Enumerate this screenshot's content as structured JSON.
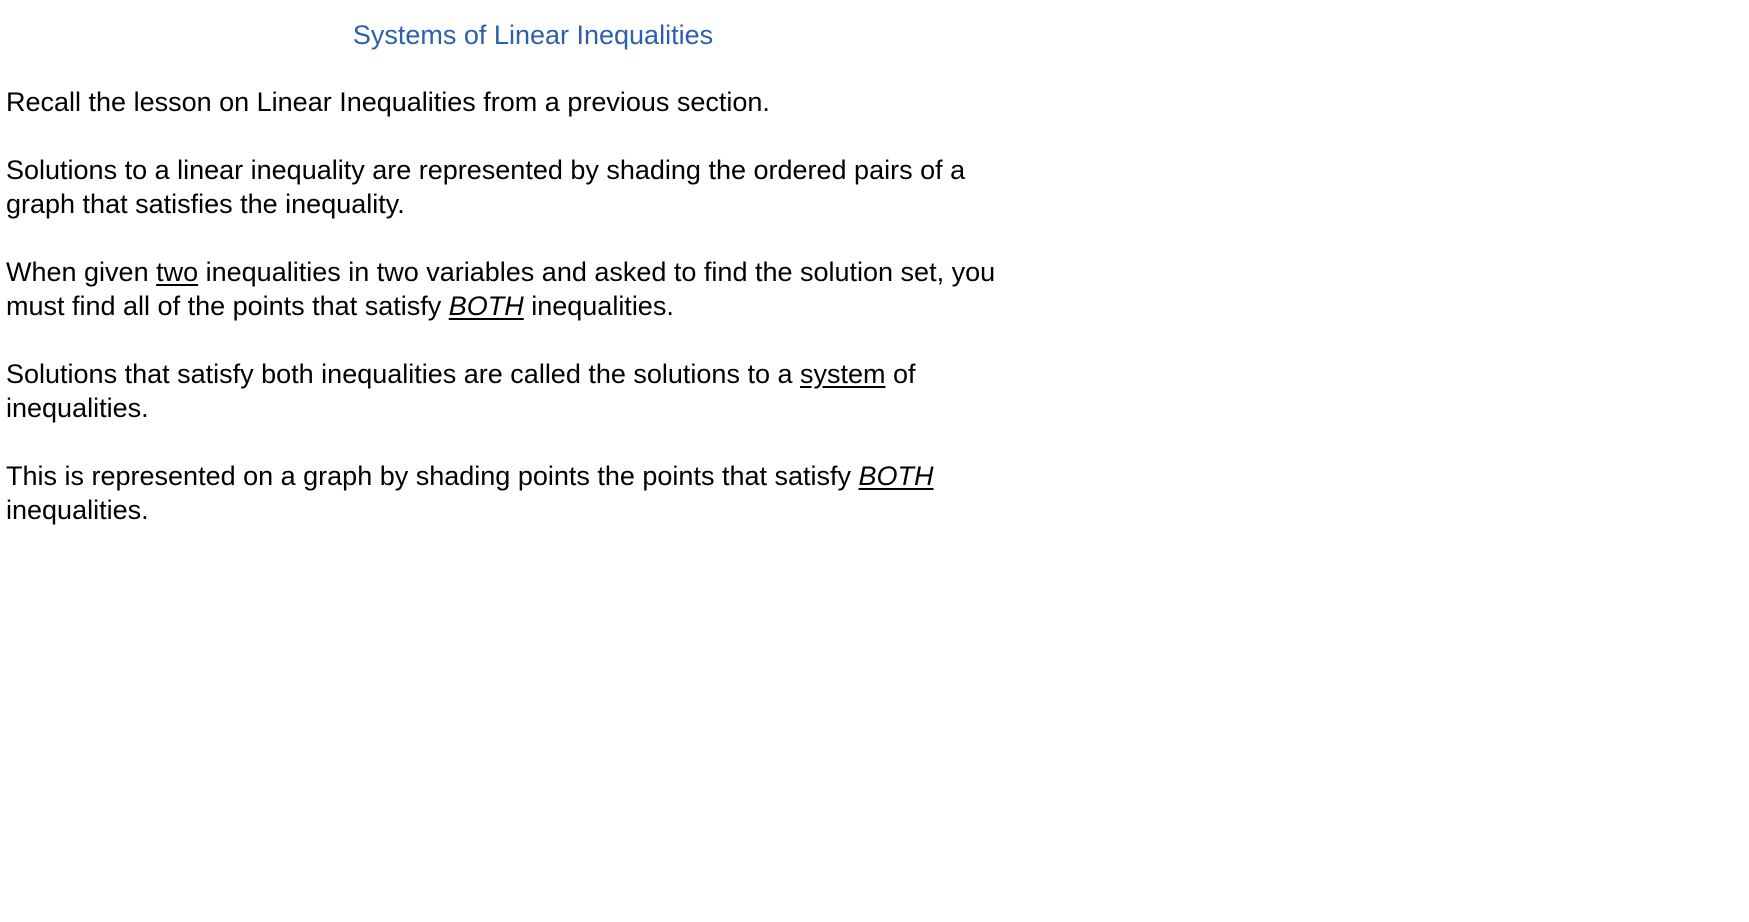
{
  "title": "Systems of Linear Inequalities",
  "colors": {
    "title": "#2e5fae",
    "text": "#000000",
    "background": "#ffffff"
  },
  "paragraphs": {
    "p1": {
      "text": "Recall the lesson on Linear Inequalities from a previous section."
    },
    "p2": {
      "line1": "Solutions to a linear inequality are represented by shading the ordered pairs of a",
      "line2": "graph that satisfies the inequality."
    },
    "p3": {
      "pre": "When given ",
      "emph": "two",
      "mid": " inequalities in two variables and asked to find the solution set, you",
      "line2_pre": "must find all of the points that satisfy ",
      "both": "BOTH",
      "line2_post": " inequalities."
    },
    "p4": {
      "pre": "Solutions that satisfy both inequalities are called the solutions to a ",
      "emph": "system",
      "post": " of",
      "line2": "inequalities."
    },
    "p5": {
      "pre": "This is represented on a graph by shading points the points that satisfy ",
      "both": "BOTH",
      "line2": "inequalities."
    }
  }
}
